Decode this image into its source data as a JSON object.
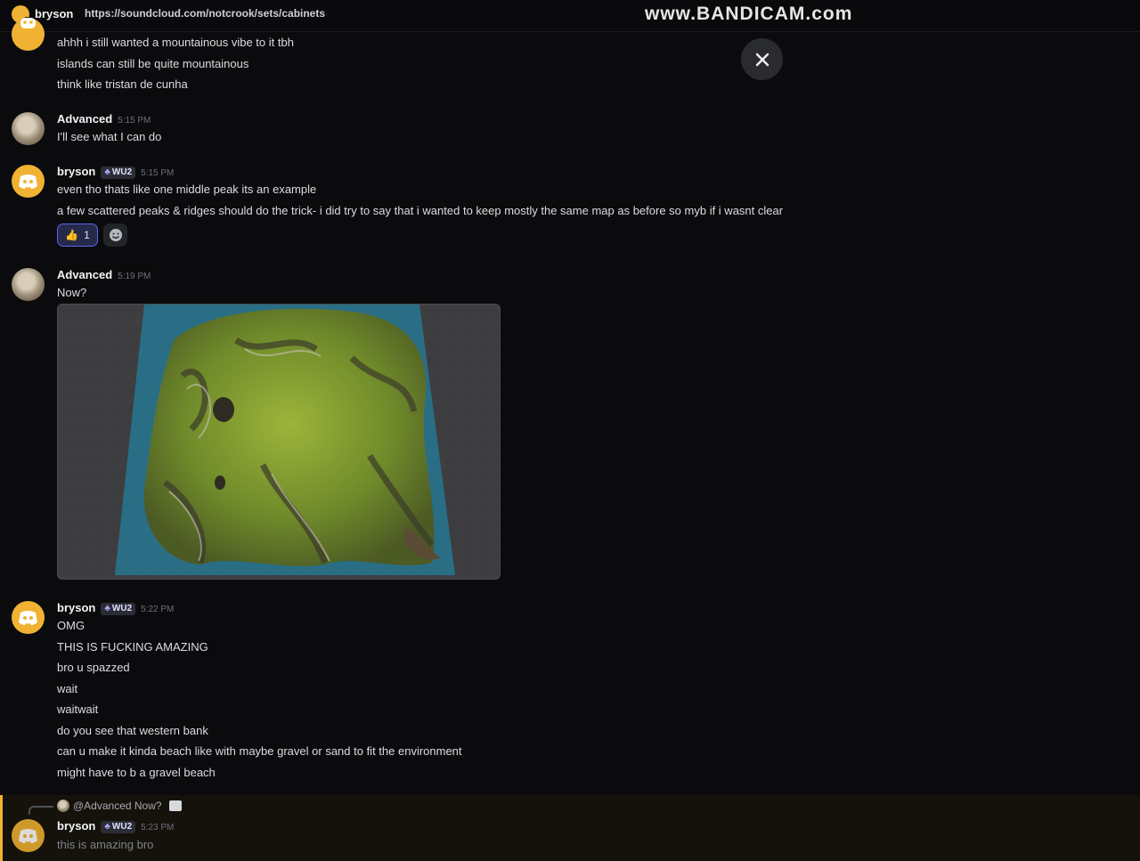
{
  "topbar": {
    "username": "bryson",
    "url": "https://soundcloud.com/notcrook/sets/cabinets",
    "watermark": "www.BANDICAM.com"
  },
  "messages": [
    {
      "author": "",
      "lines": [
        "ahhh i still wanted a mountainous vibe to it tbh",
        "islands can still be quite mountainous",
        "think like tristan de cunha"
      ]
    },
    {
      "author": "Advanced",
      "time": "5:15 PM",
      "lines": [
        "I'll see what I can do"
      ]
    },
    {
      "author": "bryson",
      "badge": "WU2",
      "time": "5:15 PM",
      "lines": [
        "even tho thats like one middle peak its an example",
        "a few scattered peaks & ridges should do the trick- i did try to say that i wanted to keep mostly the same map as before so myb if i wasnt clear"
      ],
      "reaction": {
        "emoji": "👍",
        "count": "1"
      }
    },
    {
      "author": "Advanced",
      "time": "5:19 PM",
      "lines": [
        "Now?"
      ]
    },
    {
      "author": "bryson",
      "badge": "WU2",
      "time": "5:22 PM",
      "lines": [
        "OMG",
        "THIS IS FUCKING AMAZING",
        "bro u spazzed",
        "wait",
        "waitwait",
        "do you see that western bank",
        "can u make it kinda beach like with maybe gravel or sand to fit the environment",
        "might have to b a gravel beach"
      ]
    }
  ],
  "reply": {
    "ref_text": "@Advanced Now?",
    "author": "bryson",
    "badge": "WU2",
    "time": "5:23 PM",
    "text": "this is amazing bro"
  },
  "colors": {
    "background": "#0b0b0d",
    "accent": "#f0b232",
    "blurple": "#5865f2"
  }
}
